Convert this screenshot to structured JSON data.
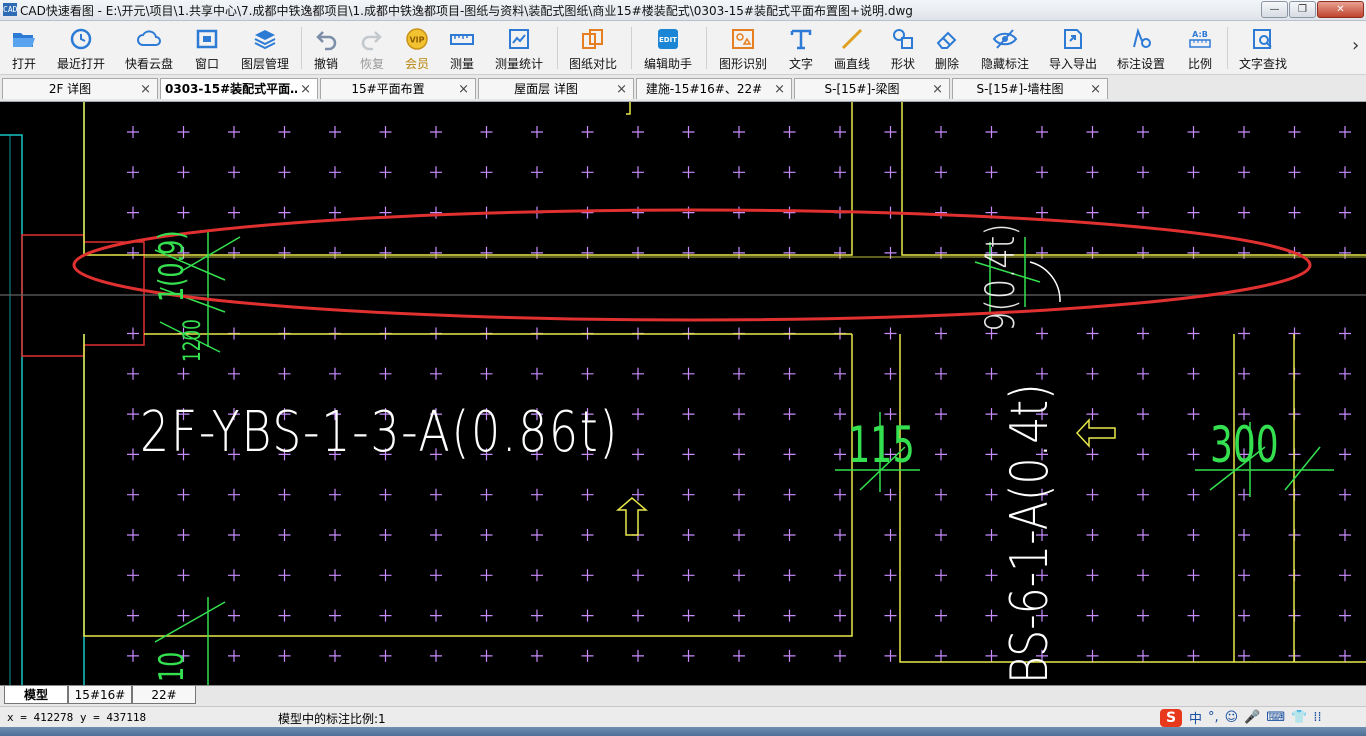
{
  "window": {
    "title": "CAD快速看图 - E:\\开元\\项目\\1.共享中心\\7.成都中铁逸都项目\\1.成都中铁逸都项目-图纸与资料\\装配式图纸\\商业15#楼装配式\\0303-15#装配式平面布置图+说明.dwg",
    "app_icon_text": "CAD"
  },
  "toolbar": {
    "items": [
      {
        "label": "打开",
        "icon": "folder-open-icon"
      },
      {
        "label": "最近打开",
        "icon": "recent-clock-icon"
      },
      {
        "label": "快看云盘",
        "icon": "cloud-icon"
      },
      {
        "label": "窗口",
        "icon": "window-icon"
      },
      {
        "label": "图层管理",
        "icon": "layers-icon"
      },
      {
        "label": "撤销",
        "icon": "undo-icon"
      },
      {
        "label": "恢复",
        "icon": "redo-icon"
      },
      {
        "label": "会员",
        "icon": "vip-badge-icon"
      },
      {
        "label": "测量",
        "icon": "ruler-icon"
      },
      {
        "label": "测量统计",
        "icon": "measure-stats-icon"
      },
      {
        "label": "图纸对比",
        "icon": "compare-icon"
      },
      {
        "label": "编辑助手",
        "icon": "edit-helper-icon"
      },
      {
        "label": "图形识别",
        "icon": "shape-recognize-icon"
      },
      {
        "label": "文字",
        "icon": "text-t-icon"
      },
      {
        "label": "画直线",
        "icon": "line-icon"
      },
      {
        "label": "形状",
        "icon": "shapes-icon"
      },
      {
        "label": "删除",
        "icon": "eraser-icon"
      },
      {
        "label": "隐藏标注",
        "icon": "hide-eye-icon"
      },
      {
        "label": "导入导出",
        "icon": "import-export-icon"
      },
      {
        "label": "标注设置",
        "icon": "annotation-settings-icon"
      },
      {
        "label": "比例",
        "icon": "scale-ratio-icon"
      },
      {
        "label": "文字查找",
        "icon": "text-search-icon"
      }
    ],
    "vip_badge_text": "VIP",
    "scale_badge_text": "A:B",
    "edit_badge_text": "EDIT",
    "more_arrow": "›"
  },
  "file_tabs": [
    {
      "label": "2F 详图",
      "active": false
    },
    {
      "label": "0303-15#装配式平面…",
      "active": true
    },
    {
      "label": "15#平面布置",
      "active": false
    },
    {
      "label": "屋面层 详图",
      "active": false
    },
    {
      "label": "建施-15#16#、22#",
      "active": false
    },
    {
      "label": "S-[15#]-梁图",
      "active": false
    },
    {
      "label": "S-[15#]-墙柱图",
      "active": false
    }
  ],
  "tab_close_glyph": "×",
  "drawing": {
    "labels": {
      "panel_main": "2F-YBS-1-3-A(0.86t)",
      "panel_side": "BS-6-1-A(0.4t)",
      "panel_top_partial": "9(0.4t)",
      "dim_115": "115",
      "dim_300": "300",
      "dim_left_top": "1(0.9)",
      "dim_left_top2": "1200",
      "dim_left_bottom": "10"
    },
    "colors": {
      "background": "#000000",
      "outline_yellow": "#e8e84a",
      "dim_green": "#34e04f",
      "grid_magenta": "#c98cff",
      "wall_cyan": "#19c4c4",
      "highlight_red": "#e03030",
      "text_white": "#ffffff"
    }
  },
  "layout_tabs": [
    {
      "label": "模型",
      "active": true
    },
    {
      "label": "15#16#",
      "active": false
    },
    {
      "label": "22#",
      "active": false
    }
  ],
  "status": {
    "coords": "x = 412278  y = 437118",
    "scale_text": "模型中的标注比例:1",
    "ime_logo": "S",
    "ime_items": [
      "中",
      "°,",
      "☺",
      "🎤",
      "⌨",
      "👕",
      "⁞⁞"
    ]
  }
}
